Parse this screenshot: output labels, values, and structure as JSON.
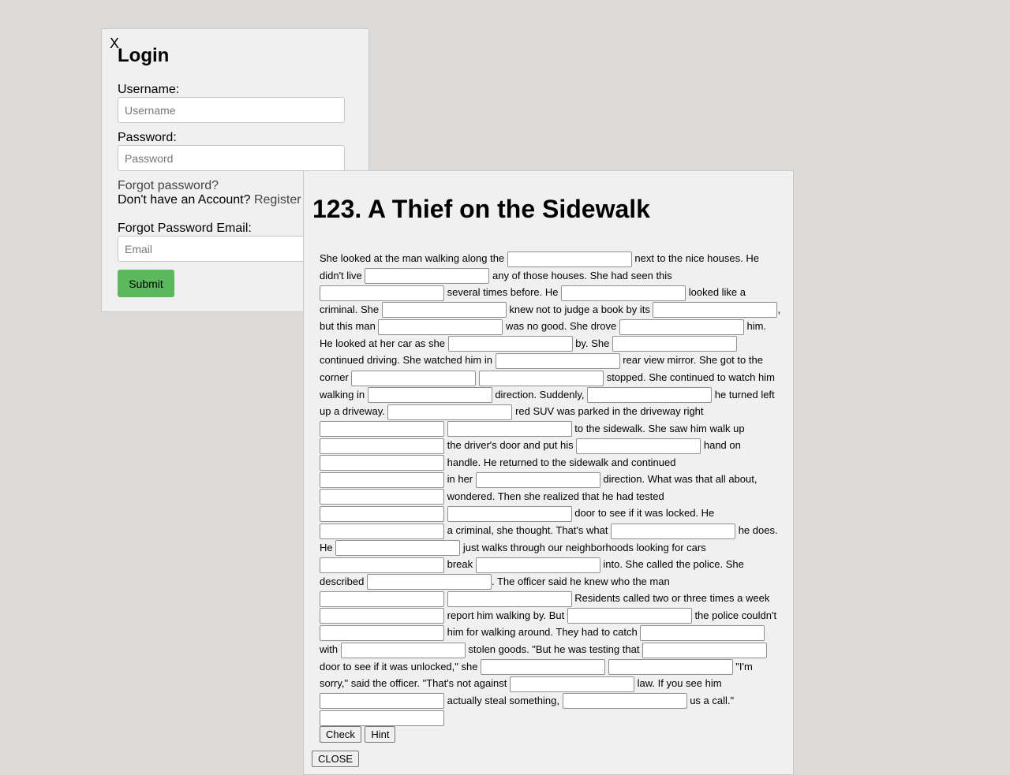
{
  "login": {
    "close": "X",
    "title": "Login",
    "username_label": "Username:",
    "username_placeholder": "Username",
    "password_label": "Password:",
    "password_placeholder": "Password",
    "forgot": "Forgot password?",
    "no_account": "Don't have an Account?",
    "register": "Register",
    "forgot_email_label": "Forgot Password Email:",
    "email_placeholder": "Email",
    "submit": "Submit"
  },
  "story": {
    "title": "123. A Thief on the Sidewalk",
    "segments": [
      "She looked at the man walking along the ",
      " next to the nice houses. He didn't live ",
      " any of those houses. She had seen this ",
      " several times before. He ",
      " looked like a criminal. She ",
      " knew not to judge a book by its ",
      ", but this man ",
      " was no good. She drove ",
      " him. He looked at her car as she ",
      " by. She ",
      " continued driving. She watched him in ",
      " rear view mirror. She got to the corner ",
      " ",
      " stopped. She continued to watch him walking in ",
      " direction. Suddenly, ",
      " he turned left up a driveway. ",
      " red SUV was parked in the driveway right ",
      " ",
      " to the sidewalk. She saw him walk up ",
      " the driver's door and put his ",
      " hand on ",
      " handle. He returned to the sidewalk and continued ",
      " in her ",
      " direction. What was that all about, ",
      " wondered. Then she realized that he had tested ",
      " ",
      " door to see if it was locked. He ",
      " a criminal, she thought. That's what ",
      " he does. He ",
      " just walks through our neighborhoods looking for cars ",
      " break ",
      " into. She called the police. She described ",
      ". The officer said he knew who the man ",
      " ",
      " Residents called two or three times a week ",
      " report him walking by. But ",
      " the police couldn't ",
      " him for walking around. They had to catch ",
      " with ",
      " stolen goods. \"But he was testing that ",
      " door to see if it was unlocked,\" she ",
      " ",
      " \"I'm sorry,\" said the officer. \"That's not against ",
      " law. If you see him ",
      " actually steal something, ",
      " us a call.\" ",
      ""
    ],
    "check": "Check",
    "hint": "Hint",
    "close": "CLOSE"
  }
}
